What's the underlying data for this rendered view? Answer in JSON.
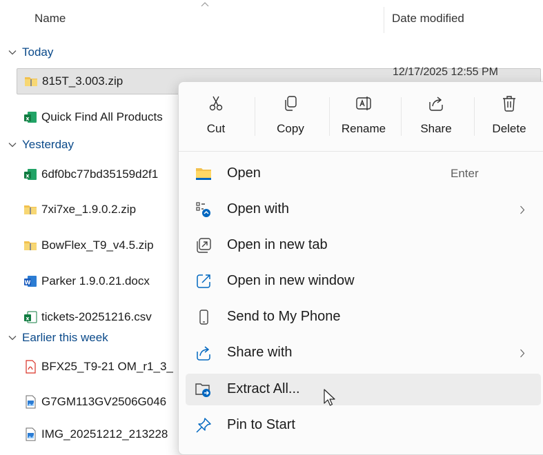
{
  "header": {
    "name_col": "Name",
    "date_col": "Date modified"
  },
  "groups": {
    "today": "Today",
    "yesterday": "Yesterday",
    "earlier": "Earlier this week"
  },
  "files": [
    {
      "name": "815T_3.003.zip",
      "date": "12/17/2025 12:55 PM",
      "icon": "zip-folder-icon",
      "selected": true
    },
    {
      "name": "Quick Find All Products",
      "icon": "excel-file-icon"
    },
    {
      "name": "6df0bc77bd35159d2f1",
      "icon": "excel-file-icon"
    },
    {
      "name": "7xi7xe_1.9.0.2.zip",
      "icon": "zip-folder-icon"
    },
    {
      "name": "BowFlex_T9_v4.5.zip",
      "icon": "zip-folder-icon"
    },
    {
      "name": "Parker 1.9.0.21.docx",
      "icon": "word-file-icon"
    },
    {
      "name": "tickets-20251216.csv",
      "icon": "csv-file-icon"
    },
    {
      "name": "BFX25_T9-21 OM_r1_3_",
      "icon": "pdf-file-icon"
    },
    {
      "name": "G7GM113GV2506G046",
      "icon": "image-file-icon"
    },
    {
      "name": "IMG_20251212_213228",
      "icon": "image-file-icon"
    }
  ],
  "context_menu": {
    "toolbar": {
      "cut": "Cut",
      "copy": "Copy",
      "rename": "Rename",
      "share": "Share",
      "delete": "Delete"
    },
    "items": [
      {
        "label": "Open",
        "shortcut": "Enter",
        "icon": "folder-icon"
      },
      {
        "label": "Open with",
        "icon": "open-with-icon",
        "submenu": true
      },
      {
        "label": "Open in new tab",
        "icon": "new-tab-icon"
      },
      {
        "label": "Open in new window",
        "icon": "new-window-icon"
      },
      {
        "label": "Send to My Phone",
        "icon": "phone-icon"
      },
      {
        "label": "Share with",
        "icon": "share-icon",
        "submenu": true
      },
      {
        "label": "Extract All...",
        "icon": "extract-icon",
        "hovered": true
      },
      {
        "label": "Pin to Start",
        "icon": "pin-icon"
      }
    ]
  },
  "colors": {
    "group_text": "#0b4a8a",
    "selection_bg": "#e3e3e3",
    "menu_bg": "#fbfbfb",
    "hover_bg": "#ececec",
    "accent_blue": "#0067c0"
  }
}
